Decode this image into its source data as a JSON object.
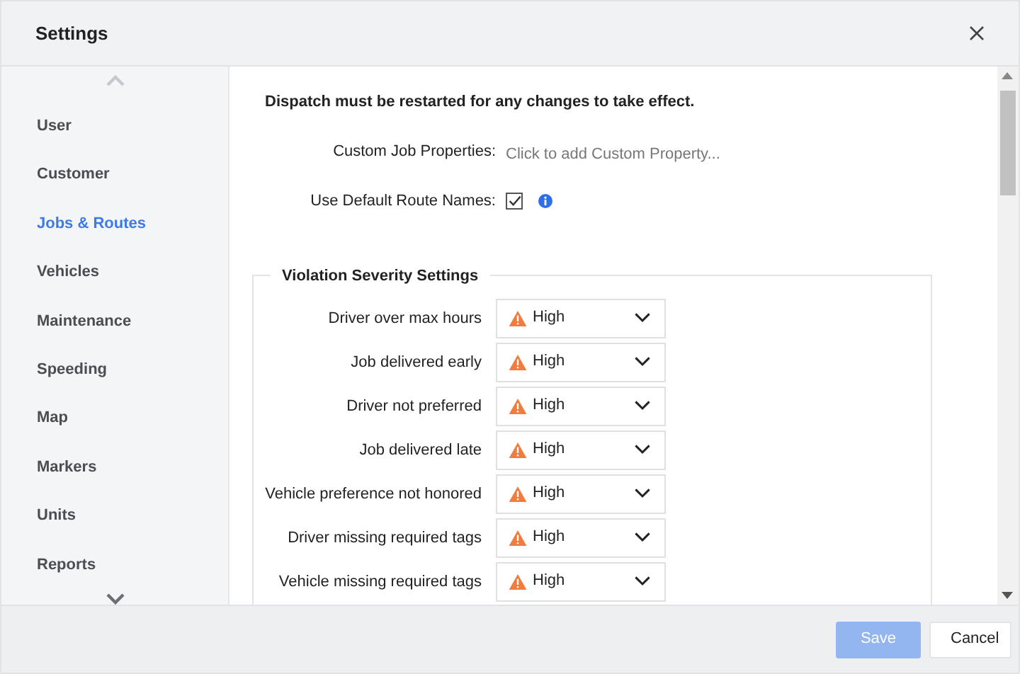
{
  "window": {
    "title": "Settings"
  },
  "sidebar": {
    "items": [
      {
        "label": "User",
        "selected": false
      },
      {
        "label": "Customer",
        "selected": false
      },
      {
        "label": "Jobs & Routes",
        "selected": true
      },
      {
        "label": "Vehicles",
        "selected": false
      },
      {
        "label": "Maintenance",
        "selected": false
      },
      {
        "label": "Speeding",
        "selected": false
      },
      {
        "label": "Map",
        "selected": false
      },
      {
        "label": "Markers",
        "selected": false
      },
      {
        "label": "Units",
        "selected": false
      },
      {
        "label": "Reports",
        "selected": false
      }
    ]
  },
  "notice": "Dispatch must be restarted for any changes to take effect.",
  "custom_job_properties": {
    "label": "Custom Job Properties:",
    "placeholder": "Click to add Custom Property..."
  },
  "use_default_route_names": {
    "label": "Use Default Route Names:",
    "checked": true
  },
  "violation_severity": {
    "title": "Violation Severity Settings",
    "rows": [
      {
        "label": "Driver over max hours",
        "value": "High"
      },
      {
        "label": "Job delivered early",
        "value": "High"
      },
      {
        "label": "Driver not preferred",
        "value": "High"
      },
      {
        "label": "Job delivered late",
        "value": "High"
      },
      {
        "label": "Vehicle preference not honored",
        "value": "High"
      },
      {
        "label": "Driver missing required tags",
        "value": "High"
      },
      {
        "label": "Vehicle missing required tags",
        "value": "High"
      }
    ]
  },
  "buttons": [
    {
      "label": "Save",
      "disabled": true
    },
    {
      "label": "Cancel",
      "disabled": false
    }
  ]
}
